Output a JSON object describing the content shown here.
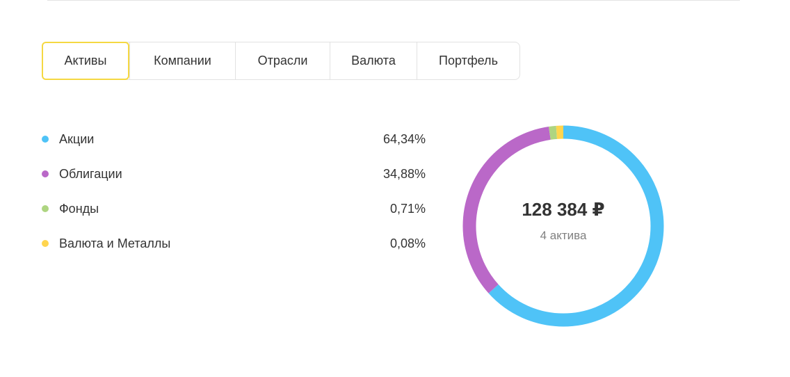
{
  "tabs": [
    {
      "label": "Активы",
      "active": true
    },
    {
      "label": "Компании",
      "active": false
    },
    {
      "label": "Отрасли",
      "active": false
    },
    {
      "label": "Валюта",
      "active": false
    },
    {
      "label": "Портфель",
      "active": false
    }
  ],
  "legend": [
    {
      "label": "Акции",
      "value": "64,34%",
      "color": "#4fc3f7"
    },
    {
      "label": "Облигации",
      "value": "34,88%",
      "color": "#ba68c8"
    },
    {
      "label": "Фонды",
      "value": "0,71%",
      "color": "#aed581"
    },
    {
      "label": "Валюта и Металлы",
      "value": "0,08%",
      "color": "#ffd54f"
    }
  ],
  "summary": {
    "total": "128 384 ₽",
    "count": "4 актива"
  },
  "chart_data": {
    "type": "pie",
    "donut": true,
    "categories": [
      "Акции",
      "Облигации",
      "Фонды",
      "Валюта и Металлы"
    ],
    "values": [
      64.34,
      34.88,
      0.71,
      0.08
    ],
    "colors": [
      "#4fc3f7",
      "#ba68c8",
      "#aed581",
      "#ffd54f"
    ]
  },
  "colors": {
    "active_tab_border": "#f5d842"
  }
}
